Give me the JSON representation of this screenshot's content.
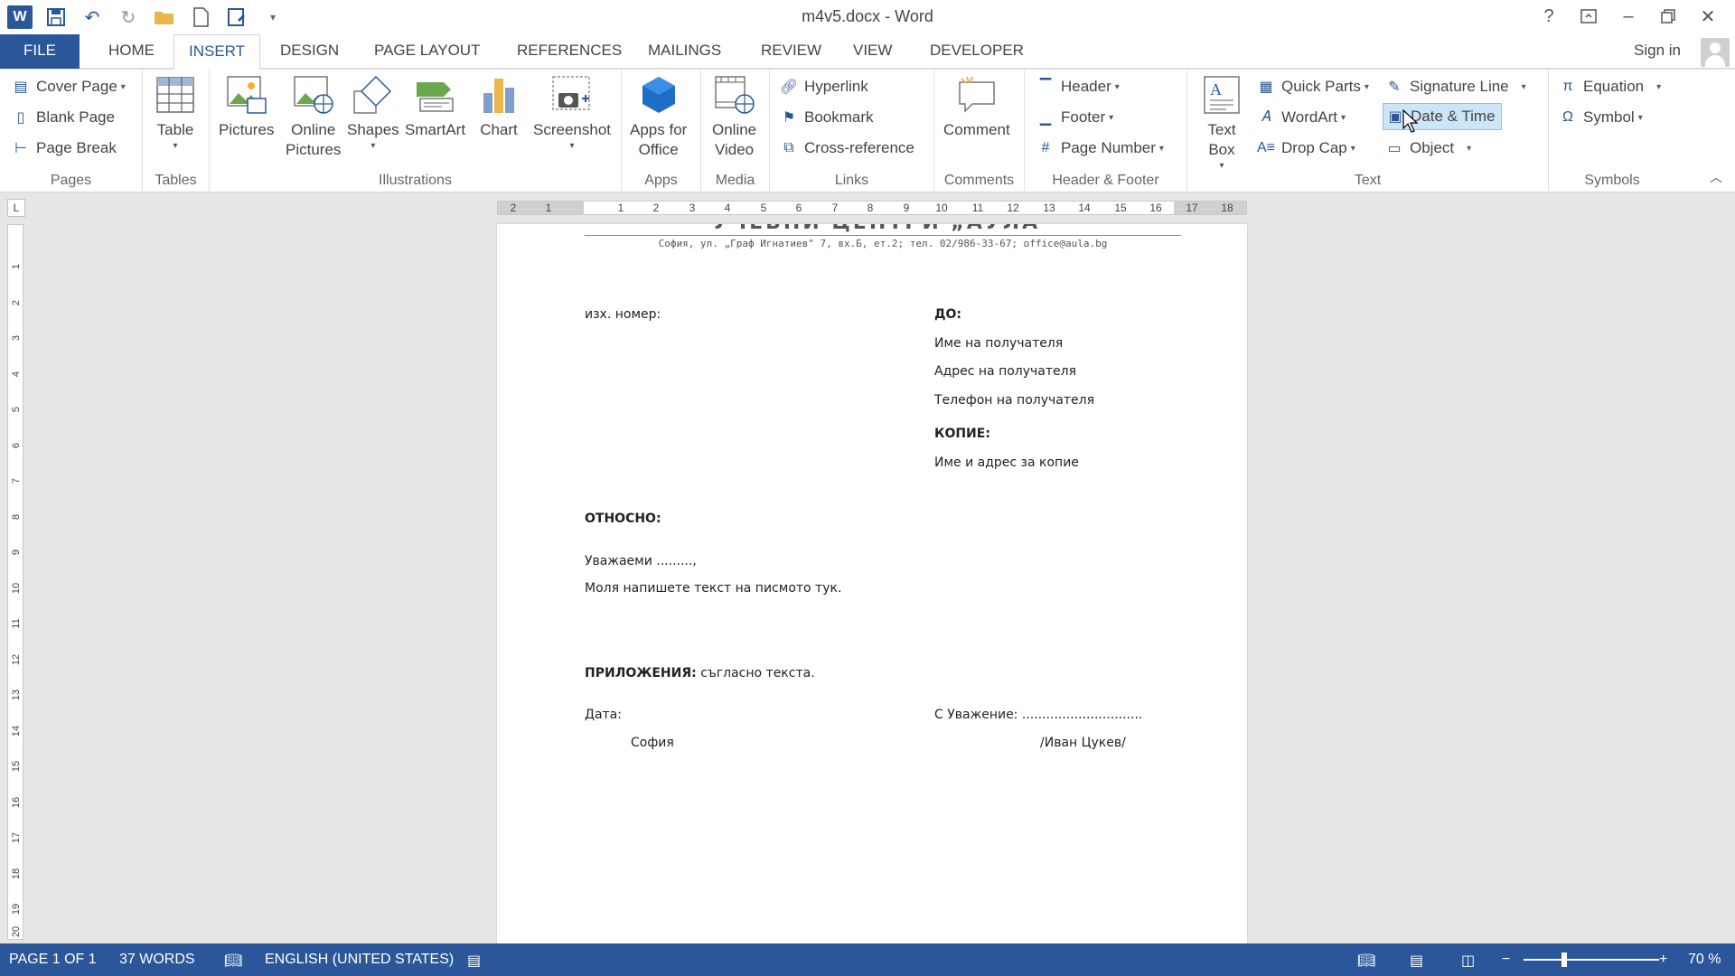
{
  "window": {
    "title": "m4v5.docx - Word"
  },
  "qat": {
    "app_icon": "W"
  },
  "tabs": [
    {
      "label": "FILE"
    },
    {
      "label": "HOME"
    },
    {
      "label": "INSERT"
    },
    {
      "label": "DESIGN"
    },
    {
      "label": "PAGE LAYOUT"
    },
    {
      "label": "REFERENCES"
    },
    {
      "label": "MAILINGS"
    },
    {
      "label": "REVIEW"
    },
    {
      "label": "VIEW"
    },
    {
      "label": "DEVELOPER"
    }
  ],
  "active_tab": "INSERT",
  "account": {
    "signin": "Sign in"
  },
  "ribbon": {
    "pages": {
      "label": "Pages",
      "cover_page": "Cover Page",
      "blank_page": "Blank Page",
      "page_break": "Page Break"
    },
    "tables": {
      "label": "Tables",
      "table": "Table"
    },
    "illustrations": {
      "label": "Illustrations",
      "pictures": "Pictures",
      "online_pictures_1": "Online",
      "online_pictures_2": "Pictures",
      "shapes": "Shapes",
      "smartart": "SmartArt",
      "chart": "Chart",
      "screenshot": "Screenshot"
    },
    "apps": {
      "label": "Apps",
      "apps_1": "Apps for",
      "apps_2": "Office"
    },
    "media": {
      "label": "Media",
      "video_1": "Online",
      "video_2": "Video"
    },
    "links": {
      "label": "Links",
      "hyperlink": "Hyperlink",
      "bookmark": "Bookmark",
      "cross_reference": "Cross-reference"
    },
    "comments": {
      "label": "Comments",
      "comment": "Comment"
    },
    "header_footer": {
      "label": "Header & Footer",
      "header": "Header",
      "footer": "Footer",
      "page_number": "Page Number"
    },
    "text": {
      "label": "Text",
      "text_box_1": "Text",
      "text_box_2": "Box",
      "quick_parts": "Quick Parts",
      "wordart": "WordArt",
      "drop_cap": "Drop Cap",
      "signature_line": "Signature Line",
      "date_time": "Date & Time",
      "object": "Object"
    },
    "symbols": {
      "label": "Symbols",
      "equation": "Equation",
      "symbol": "Symbol"
    }
  },
  "ruler": {
    "h_numbers": [
      "2",
      "1",
      "1",
      "2",
      "3",
      "4",
      "5",
      "6",
      "7",
      "8",
      "9",
      "10",
      "11",
      "12",
      "13",
      "14",
      "15",
      "16",
      "17",
      "18"
    ],
    "v_numbers": [
      "1",
      "2",
      "3",
      "4",
      "5",
      "6",
      "7",
      "8",
      "9",
      "10",
      "11",
      "12",
      "13",
      "14",
      "15",
      "16",
      "17",
      "18",
      "19",
      "20"
    ]
  },
  "document": {
    "letterhead": "УЧЕБНИ ЦЕНТРИ „АУЛА\"",
    "address": "София, ул. „Граф Игнатиев\" 7, вх.Б, ет.2; тел. 02/986-33-67; office@aula.bg",
    "out_number": "изх. номер:",
    "to": "ДО:",
    "recipient_name": "Име на получателя",
    "recipient_address": "Адрес на получателя",
    "recipient_phone": "Телефон на получателя",
    "copies": "КОПИЕ:",
    "copies_text": "Име и адрес за копие",
    "regarding": "ОТНОСНО:",
    "greeting": "Уважаеми .........,",
    "body": "Моля напишете текст на писмото тук.",
    "attachments_label": "ПРИЛОЖЕНИЯ:",
    "attachments_text": "съгласно текста.",
    "date_label": "Дата:",
    "city": "София",
    "regards": "С Уважение: ..............................",
    "signatory": "/Иван Цукев/"
  },
  "status": {
    "page": "PAGE 1 OF 1",
    "words": "37 WORDS",
    "language": "ENGLISH (UNITED STATES)",
    "zoom": "70 %",
    "zoom_minus": "−",
    "zoom_plus": "+"
  },
  "colors": {
    "accent": "#2b579a",
    "highlight": "#cde6f7"
  }
}
